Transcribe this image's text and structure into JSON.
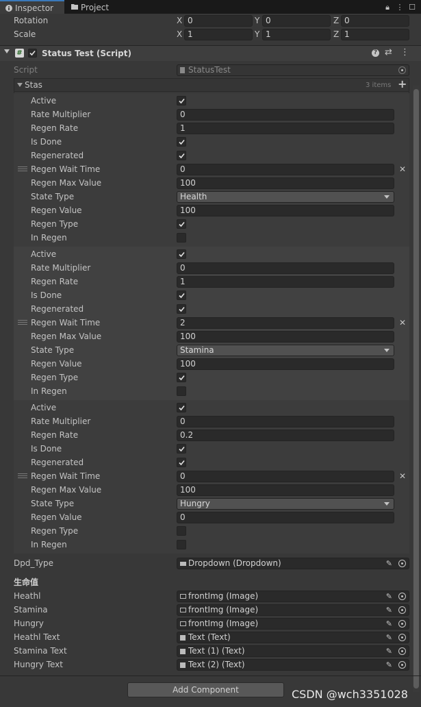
{
  "tabs": [
    {
      "label": "Inspector",
      "icon": "info-icon"
    },
    {
      "label": "Project",
      "icon": "folder-icon"
    }
  ],
  "transform": {
    "rotation": {
      "label": "Rotation",
      "x": "0",
      "y": "0",
      "z": "0"
    },
    "scale": {
      "label": "Scale",
      "x": "1",
      "y": "1",
      "z": "1"
    },
    "axes": [
      "X",
      "Y",
      "Z"
    ]
  },
  "component": {
    "title": "Status Test (Script)",
    "enabled": true,
    "script_label": "Script",
    "script_value": "StatusTest",
    "list_label": "Stas",
    "list_count": "3 items"
  },
  "field_labels": {
    "active": "Active",
    "rate_multiplier": "Rate Multiplier",
    "regen_rate": "Regen Rate",
    "is_done": "Is Done",
    "regenerated": "Regenerated",
    "regen_wait_time": "Regen Wait Time",
    "regen_max_value": "Regen Max Value",
    "state_type": "State Type",
    "regen_value": "Regen Value",
    "regen_type": "Regen Type",
    "in_regen": "In Regen"
  },
  "elements": [
    {
      "active": true,
      "rate_multiplier": "0",
      "regen_rate": "1",
      "is_done": true,
      "regenerated": true,
      "regen_wait_time": "0",
      "regen_max_value": "100",
      "state_type": "Health",
      "regen_value": "100",
      "regen_type": true,
      "in_regen": false
    },
    {
      "active": true,
      "rate_multiplier": "0",
      "regen_rate": "1",
      "is_done": true,
      "regenerated": true,
      "regen_wait_time": "2",
      "regen_max_value": "100",
      "state_type": "Stamina",
      "regen_value": "100",
      "regen_type": true,
      "in_regen": false
    },
    {
      "active": true,
      "rate_multiplier": "0",
      "regen_rate": "0.2",
      "is_done": true,
      "regenerated": true,
      "regen_wait_time": "0",
      "regen_max_value": "100",
      "state_type": "Hungry",
      "regen_value": "0",
      "regen_type": false,
      "in_regen": false
    }
  ],
  "dpd_type": {
    "label": "Dpd_Type",
    "value": "Dropdown (Dropdown)"
  },
  "section_header": "生命值",
  "refs": [
    {
      "label": "Heathl",
      "value": "frontImg (Image)",
      "kind": "image"
    },
    {
      "label": "Stamina",
      "value": "frontImg (Image)",
      "kind": "image"
    },
    {
      "label": "Hungry",
      "value": "frontImg (Image)",
      "kind": "image"
    },
    {
      "label": "Heathl Text",
      "value": "Text (Text)",
      "kind": "text"
    },
    {
      "label": "Stamina Text",
      "value": "Text (1) (Text)",
      "kind": "text"
    },
    {
      "label": "Hungry Text",
      "value": "Text (2) (Text)",
      "kind": "text"
    }
  ],
  "add_component": "Add Component",
  "watermark": "CSDN @wch3351028"
}
